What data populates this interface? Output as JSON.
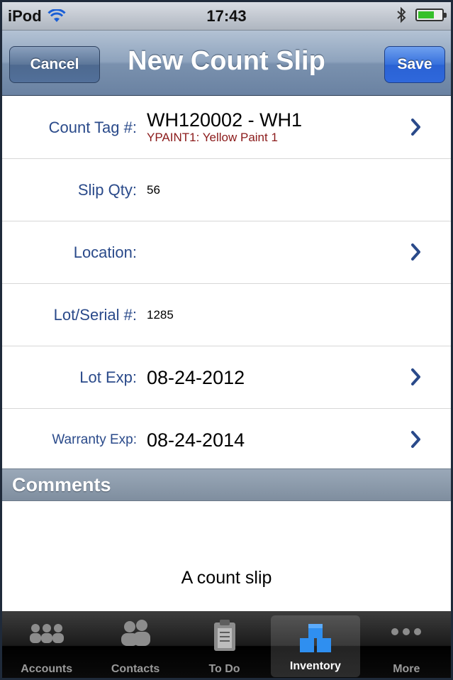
{
  "status_bar": {
    "carrier": "iPod",
    "time": "17:43"
  },
  "nav": {
    "title": "New Count Slip",
    "cancel_label": "Cancel",
    "save_label": "Save"
  },
  "form": {
    "count_tag": {
      "label": "Count Tag #:",
      "value": "WH120002 - WH1",
      "subvalue": "YPAINT1: Yellow Paint 1"
    },
    "slip_qty": {
      "label": "Slip Qty:",
      "value": "56"
    },
    "location": {
      "label": "Location:",
      "value": ""
    },
    "lot_serial": {
      "label": "Lot/Serial #:",
      "value": "1285"
    },
    "lot_exp": {
      "label": "Lot Exp:",
      "value": "08-24-2012"
    },
    "warranty_exp": {
      "label": "Warranty Exp:",
      "value": "08-24-2014"
    }
  },
  "comments": {
    "header": "Comments",
    "text": "A count slip"
  },
  "tab_bar": {
    "tabs": [
      {
        "label": "Accounts",
        "icon": "accounts-icon"
      },
      {
        "label": "Contacts",
        "icon": "contacts-icon"
      },
      {
        "label": "To Do",
        "icon": "todo-clipboard-icon"
      },
      {
        "label": "Inventory",
        "icon": "inventory-icon",
        "active": true
      },
      {
        "label": "More",
        "icon": "more-dots-icon"
      }
    ]
  },
  "colors": {
    "label_blue": "#2a4a8a",
    "subvalue_red": "#8b1a1a",
    "save_blue": "#3670dc",
    "chevron_blue": "#2a4a8a"
  }
}
